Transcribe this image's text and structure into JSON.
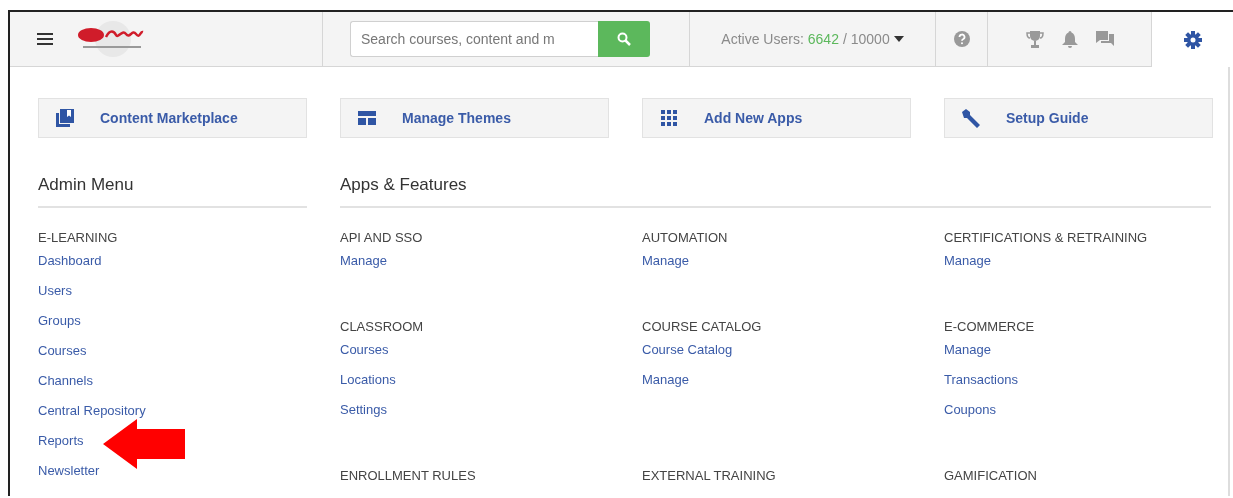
{
  "header": {
    "search": {
      "placeholder": "Search courses, content and m"
    },
    "active_users": {
      "label": "Active Users:",
      "count": "6642",
      "total": "/ 10000"
    }
  },
  "shortcuts": [
    {
      "kind": "marketplace",
      "label": "Content Marketplace"
    },
    {
      "kind": "themes",
      "label": "Manage Themes"
    },
    {
      "kind": "apps",
      "label": "Add New Apps"
    },
    {
      "kind": "guide",
      "label": "Setup Guide"
    }
  ],
  "admin_menu": {
    "title": "Admin Menu",
    "sections": [
      {
        "heading": "E-LEARNING",
        "links": [
          "Dashboard",
          "Users",
          "Groups",
          "Courses",
          "Channels",
          "Central Repository",
          "Reports",
          "Newsletter"
        ]
      }
    ]
  },
  "apps_features": {
    "title": "Apps & Features",
    "sections": [
      {
        "heading": "API AND SSO",
        "links": [
          "Manage"
        ]
      },
      {
        "heading": "AUTOMATION",
        "links": [
          "Manage"
        ]
      },
      {
        "heading": "CERTIFICATIONS & RETRAINING",
        "links": [
          "Manage"
        ]
      },
      {
        "heading": "CLASSROOM",
        "links": [
          "Courses",
          "Locations",
          "Settings"
        ]
      },
      {
        "heading": "COURSE CATALOG",
        "links": [
          "Course Catalog",
          "Manage"
        ]
      },
      {
        "heading": "E-COMMERCE",
        "links": [
          "Manage",
          "Transactions",
          "Coupons"
        ]
      },
      {
        "heading": "ENROLLMENT RULES"
      },
      {
        "heading": "EXTERNAL TRAINING"
      },
      {
        "heading": "GAMIFICATION"
      }
    ]
  }
}
